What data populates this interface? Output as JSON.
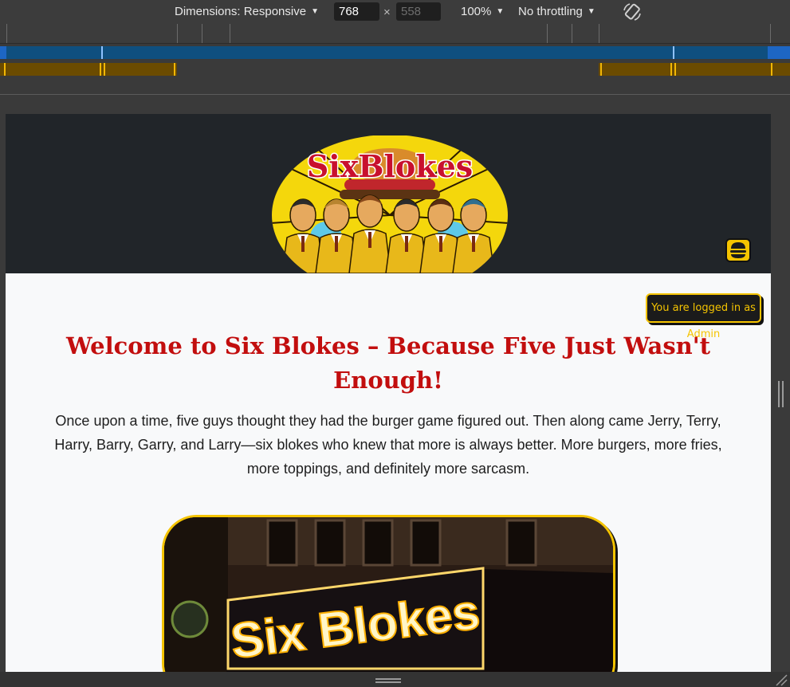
{
  "devtools": {
    "dimensions_label": "Dimensions: Responsive",
    "width_value": "768",
    "height_value": "558",
    "dimension_separator": "×",
    "zoom_label": "100%",
    "throttling_label": "No throttling",
    "caret": "▼"
  },
  "colors": {
    "header_bg": "#212529",
    "accent_yellow": "#f5c400",
    "title_red": "#c20e0e",
    "page_bg": "#f8f9fa"
  },
  "site": {
    "logo_text": "SixBlokes",
    "admin_badge": "You are logged in as Admin",
    "welcome_title": "Welcome to Six Blokes – Because Five Just Wasn't Enough!",
    "intro_text": "Once upon a time, five guys thought they had the burger game figured out. Then along came Jerry, Terry, Harry, Barry, Garry, and Larry—six blokes who knew that more is always better. More burgers, more fries, more toppings, and definitely more sarcasm.",
    "storefront_sign": "Six Blokes",
    "menu_icon": "burger-icon"
  }
}
